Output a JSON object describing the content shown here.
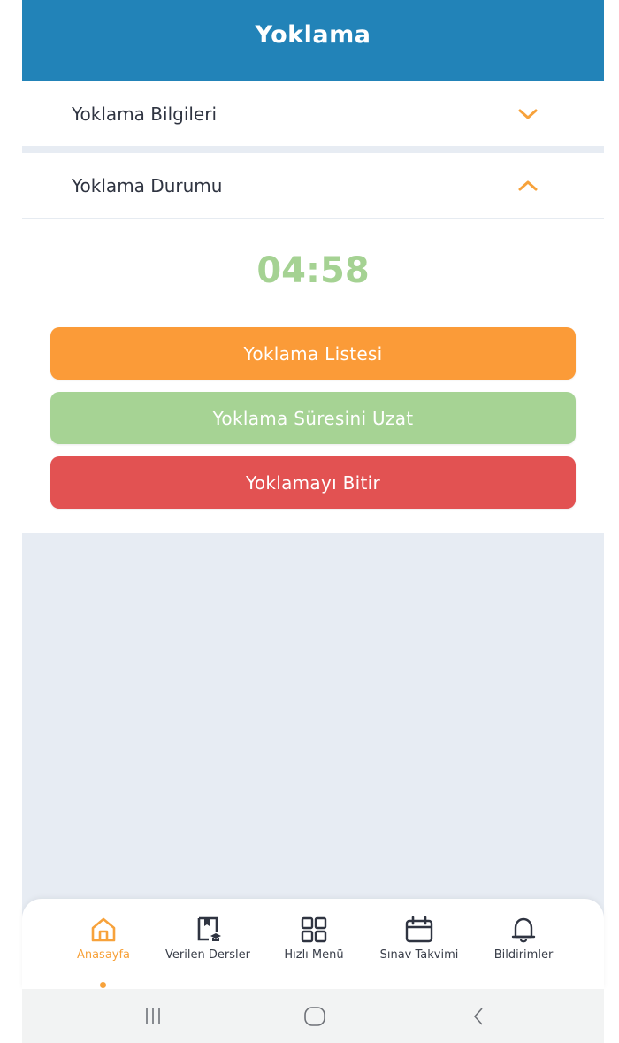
{
  "header": {
    "title": "Yoklama"
  },
  "accordion": {
    "items": [
      {
        "label": "Yoklama Bilgileri",
        "state": "collapsed"
      },
      {
        "label": "Yoklama Durumu",
        "state": "expanded"
      }
    ]
  },
  "status": {
    "timer": "04:58",
    "buttons": [
      {
        "label": "Yoklama Listesi",
        "color": "#fb9b38"
      },
      {
        "label": "Yoklama Süresini Uzat",
        "color": "#a6d394"
      },
      {
        "label": "Yoklamayı Bitir",
        "color": "#e25252"
      }
    ]
  },
  "bottom_nav": {
    "items": [
      {
        "label": "Anasayfa",
        "icon": "home-icon",
        "active": true
      },
      {
        "label": "Verilen Dersler",
        "icon": "courses-icon",
        "active": false
      },
      {
        "label": "Hızlı Menü",
        "icon": "grid-icon",
        "active": false
      },
      {
        "label": "Sınav Takvimi",
        "icon": "calendar-icon",
        "active": false
      },
      {
        "label": "Bildirimler",
        "icon": "bell-icon",
        "active": false
      }
    ]
  },
  "system_nav": {
    "buttons": [
      "recent-apps-icon",
      "home-circle-icon",
      "back-icon"
    ]
  },
  "colors": {
    "header": "#2283b8",
    "accent": "#f7a23b",
    "timer": "#a5d293",
    "background": "#e7ecf3"
  }
}
